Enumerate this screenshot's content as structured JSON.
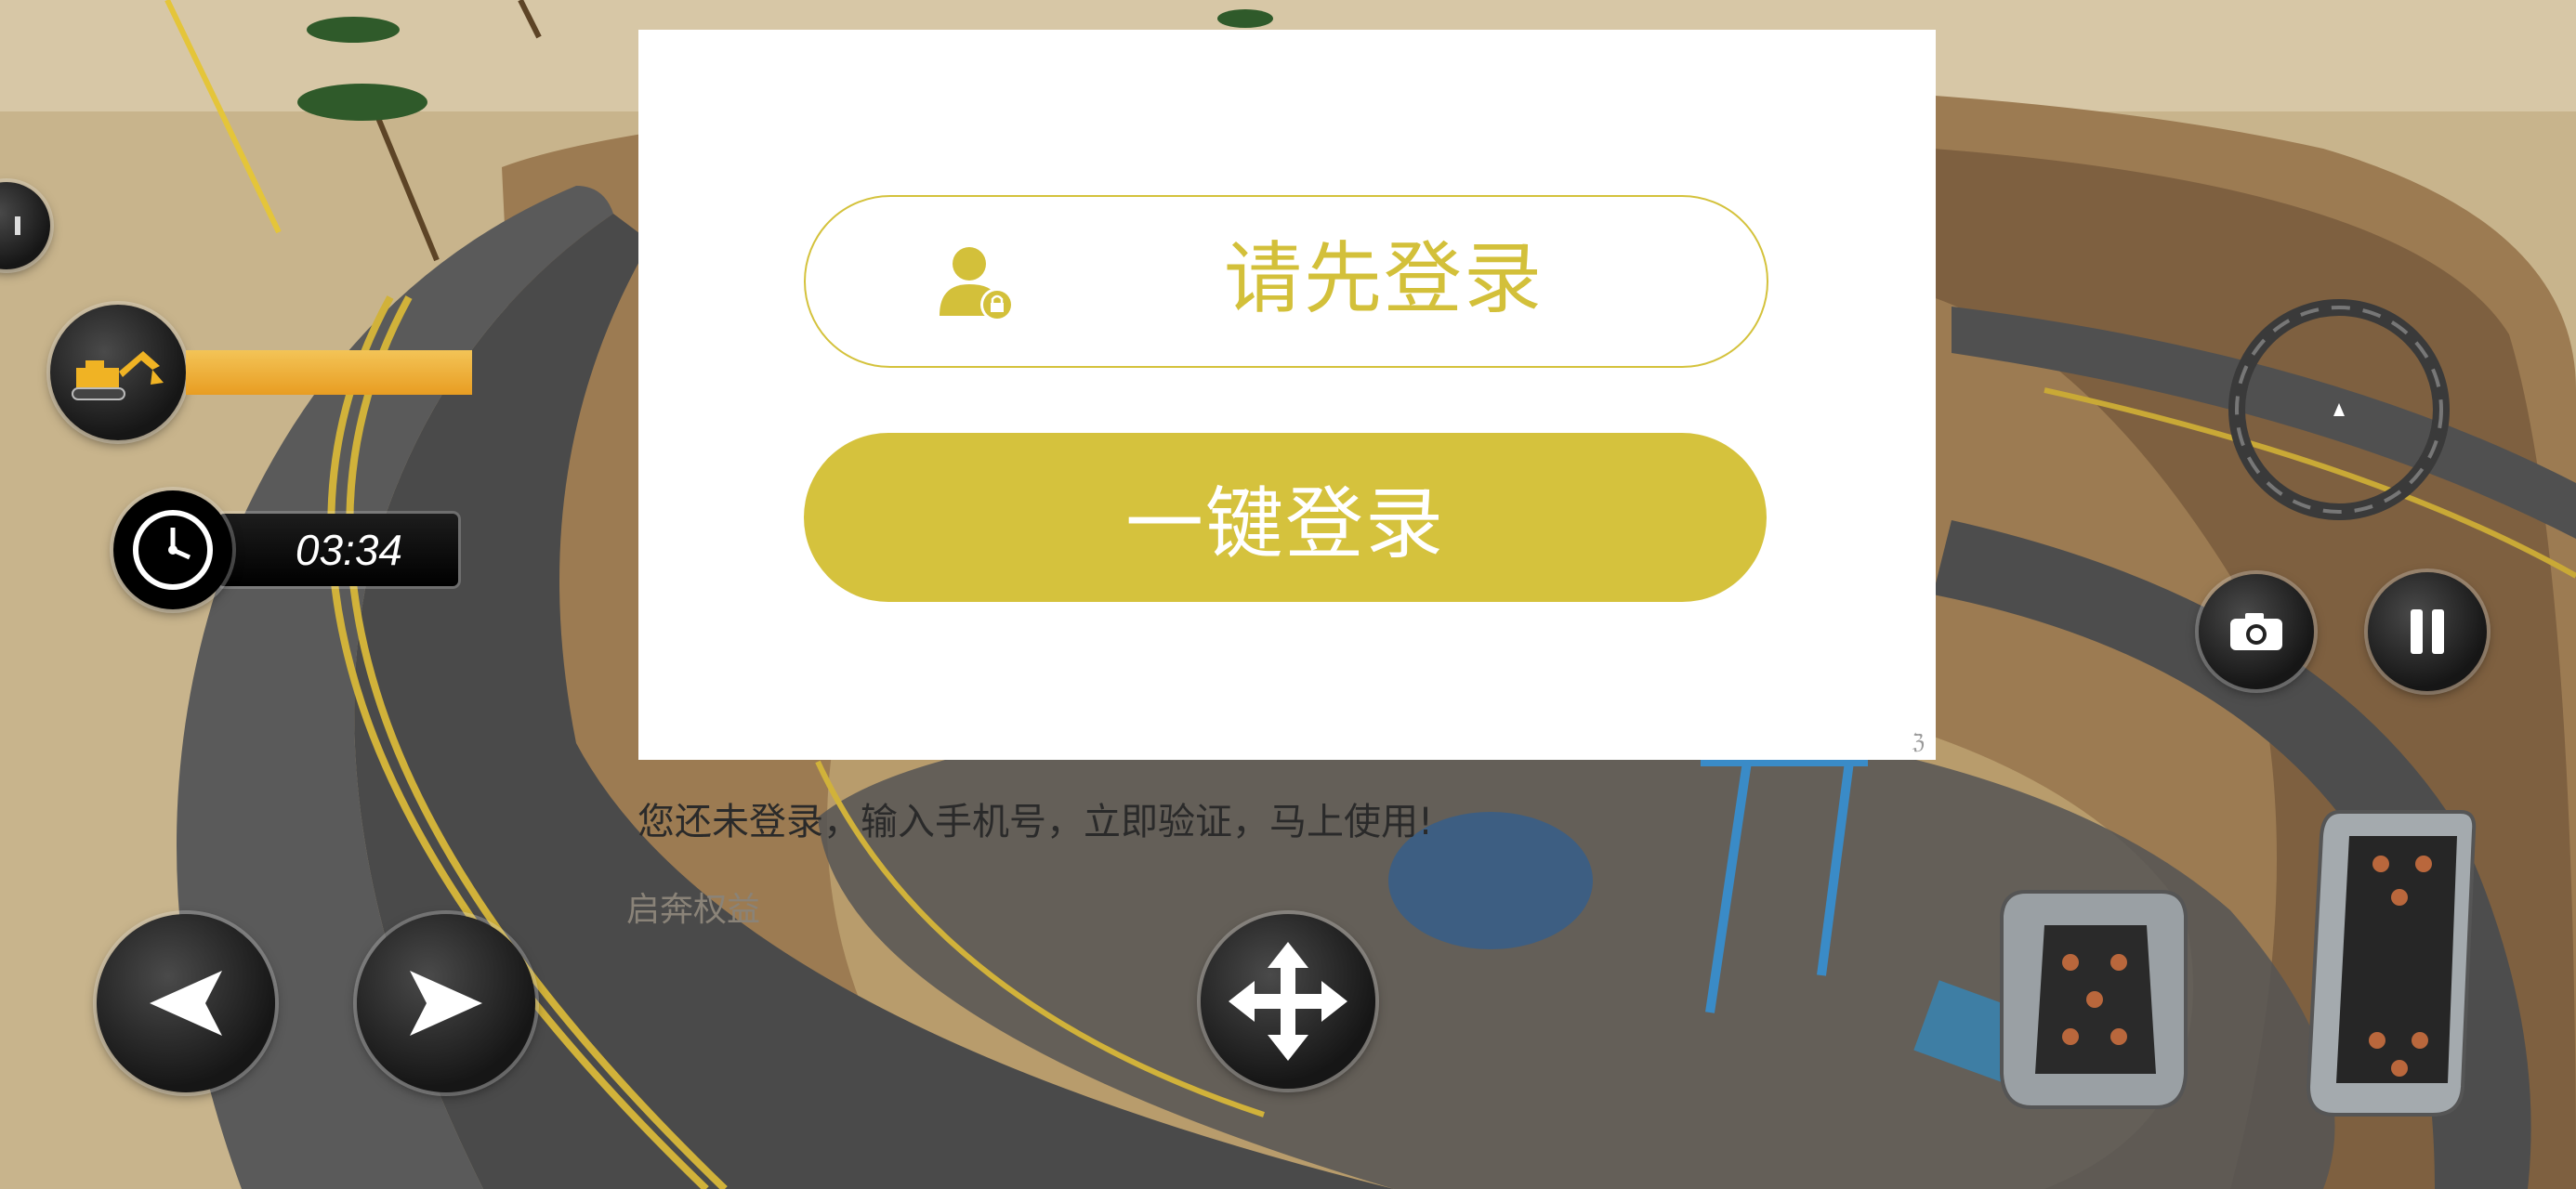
{
  "login_dialog": {
    "prompt_label": "请先登录",
    "login_button_label": "一键登录",
    "corner_mark": "ℨ"
  },
  "hint": {
    "message": "您还未登录，输入手机号，立即验证，马上使用!",
    "secondary": "启奔权益"
  },
  "hud": {
    "timer": "03:34",
    "progress_fraction": 1.0,
    "icons": {
      "vehicle": "excavator-icon",
      "timer": "clock-icon",
      "camera": "camera-icon",
      "pause": "pause-icon",
      "left": "arrow-left-icon",
      "right": "arrow-right-icon",
      "move": "move-arrows-icon",
      "brake": "brake-pedal-icon",
      "gas": "gas-pedal-icon",
      "minimap": "minimap-compass-icon"
    },
    "colors": {
      "accent": "#d5c23d",
      "progress": "#eaa42b"
    }
  }
}
